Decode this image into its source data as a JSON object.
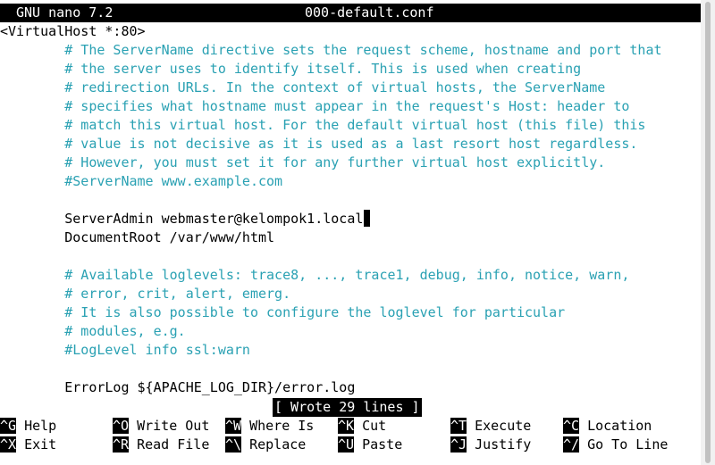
{
  "titlebar": {
    "app": "GNU nano 7.2",
    "filename": "000-default.conf"
  },
  "editor": {
    "lines": [
      {
        "text": "<VirtualHost *:80>",
        "type": "code"
      },
      {
        "text": "        # The ServerName directive sets the request scheme, hostname and port that",
        "type": "comment"
      },
      {
        "text": "        # the server uses to identify itself. This is used when creating",
        "type": "comment"
      },
      {
        "text": "        # redirection URLs. In the context of virtual hosts, the ServerName",
        "type": "comment"
      },
      {
        "text": "        # specifies what hostname must appear in the request's Host: header to",
        "type": "comment"
      },
      {
        "text": "        # match this virtual host. For the default virtual host (this file) this",
        "type": "comment"
      },
      {
        "text": "        # value is not decisive as it is used as a last resort host regardless.",
        "type": "comment"
      },
      {
        "text": "        # However, you must set it for any further virtual host explicitly.",
        "type": "comment"
      },
      {
        "text": "        #ServerName www.example.com",
        "type": "comment"
      },
      {
        "text": "",
        "type": "code"
      },
      {
        "text": "        ServerAdmin webmaster@kelompok1.local",
        "type": "code",
        "cursor": true
      },
      {
        "text": "        DocumentRoot /var/www/html",
        "type": "code"
      },
      {
        "text": "",
        "type": "code"
      },
      {
        "text": "        # Available loglevels: trace8, ..., trace1, debug, info, notice, warn,",
        "type": "comment"
      },
      {
        "text": "        # error, crit, alert, emerg.",
        "type": "comment"
      },
      {
        "text": "        # It is also possible to configure the loglevel for particular",
        "type": "comment"
      },
      {
        "text": "        # modules, e.g.",
        "type": "comment"
      },
      {
        "text": "        #LogLevel info ssl:warn",
        "type": "comment"
      },
      {
        "text": "",
        "type": "code"
      },
      {
        "text": "        ErrorLog ${APACHE_LOG_DIR}/error.log",
        "type": "code"
      }
    ]
  },
  "status": "[ Wrote 29 lines ]",
  "shortcuts": [
    {
      "key": "^G",
      "label": "Help"
    },
    {
      "key": "^O",
      "label": "Write Out"
    },
    {
      "key": "^W",
      "label": "Where Is"
    },
    {
      "key": "^K",
      "label": "Cut"
    },
    {
      "key": "^T",
      "label": "Execute"
    },
    {
      "key": "^C",
      "label": "Location"
    },
    {
      "key": "^X",
      "label": "Exit"
    },
    {
      "key": "^R",
      "label": "Read File"
    },
    {
      "key": "^\\",
      "label": "Replace"
    },
    {
      "key": "^U",
      "label": "Paste"
    },
    {
      "key": "^J",
      "label": "Justify"
    },
    {
      "key": "^/",
      "label": "Go To Line"
    }
  ],
  "colors": {
    "comment": "#2aa1b3",
    "text": "#000000",
    "background": "#ffffff",
    "bar": "#000000"
  }
}
